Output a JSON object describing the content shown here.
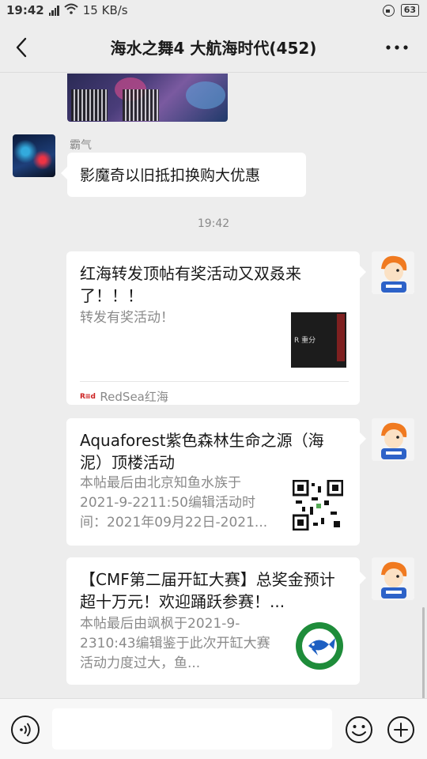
{
  "status_bar": {
    "time": "19:42",
    "network": "4G",
    "speed": "15 KB/s",
    "battery": "63"
  },
  "header": {
    "title": "海水之舞4 大航海时代(452)"
  },
  "messages": {
    "text_message": {
      "sender": "霸气",
      "text": "影魔奇以旧抵扣换购大优惠"
    },
    "timestamp": "19:42",
    "cards": [
      {
        "title": "红海转发顶帖有奖活动又双叒来了！！！",
        "desc": "转发有奖活动！",
        "source": "RedSea红海",
        "thumb_text": "R 重分"
      },
      {
        "title": "Aquaforest紫色森林生命之源（海泥）顶楼活动",
        "desc": "本帖最后由北京知鱼水族于2021-9-2211:50编辑活动时间：2021年09月22日-2021..."
      },
      {
        "title": "【CMF第二届开缸大赛】总奖金预计超十万元！欢迎踊跃参赛！...",
        "desc": "本帖最后由飒枫于2021-9-2310:43编辑鉴于此次开缸大赛活动力度过大，鱼..."
      }
    ]
  },
  "input": {
    "placeholder": ""
  },
  "icons": {
    "back": "chevron-left-icon",
    "more": "more-icon",
    "voice": "voice-icon",
    "emoji": "emoji-icon",
    "plus": "plus-icon"
  },
  "colors": {
    "background": "#ededed",
    "bubble": "#ffffff",
    "meta_text": "#8a8a8a"
  }
}
